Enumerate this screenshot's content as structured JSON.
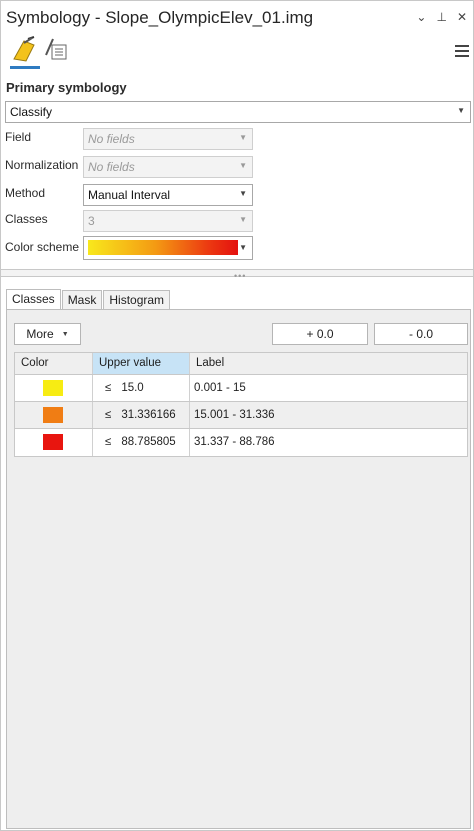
{
  "window": {
    "title": "Symbology - Slope_OlympicElev_01.img",
    "controls": {
      "options": "⌄",
      "pin": "⊥",
      "close": "✕"
    }
  },
  "toolbar": {
    "primary_icon": "primary-symbology-icon",
    "secondary_icon": "secondary-symbology-icon",
    "menu_icon": "hamburger-menu-icon"
  },
  "primary": {
    "heading": "Primary symbology",
    "renderer": "Classify",
    "field_label": "Field",
    "field_value": "No fields",
    "normalization_label": "Normalization",
    "normalization_value": "No fields",
    "method_label": "Method",
    "method_value": "Manual Interval",
    "classes_label": "Classes",
    "classes_value": "3",
    "color_scheme_label": "Color scheme",
    "color_scheme_colors": [
      "#f8e81c",
      "#f49a13",
      "#ec3a11",
      "#e4110f"
    ]
  },
  "tabs": [
    "Classes",
    "Mask",
    "Histogram"
  ],
  "classes_panel": {
    "more_label": "More",
    "add_decimal_label": "+ 0.0",
    "remove_decimal_label": "- 0.0",
    "columns": [
      "Color",
      "Upper value",
      "Label"
    ],
    "rows": [
      {
        "color": "#f7ec13",
        "symbol": "≤",
        "upper": "15.0",
        "label": "0.001 - 15"
      },
      {
        "color": "#f07d14",
        "symbol": "≤",
        "upper": "31.336166",
        "label": "15.001 - 31.336"
      },
      {
        "color": "#e8150f",
        "symbol": "≤",
        "upper": "88.785805",
        "label": "31.337 - 88.786"
      }
    ]
  }
}
